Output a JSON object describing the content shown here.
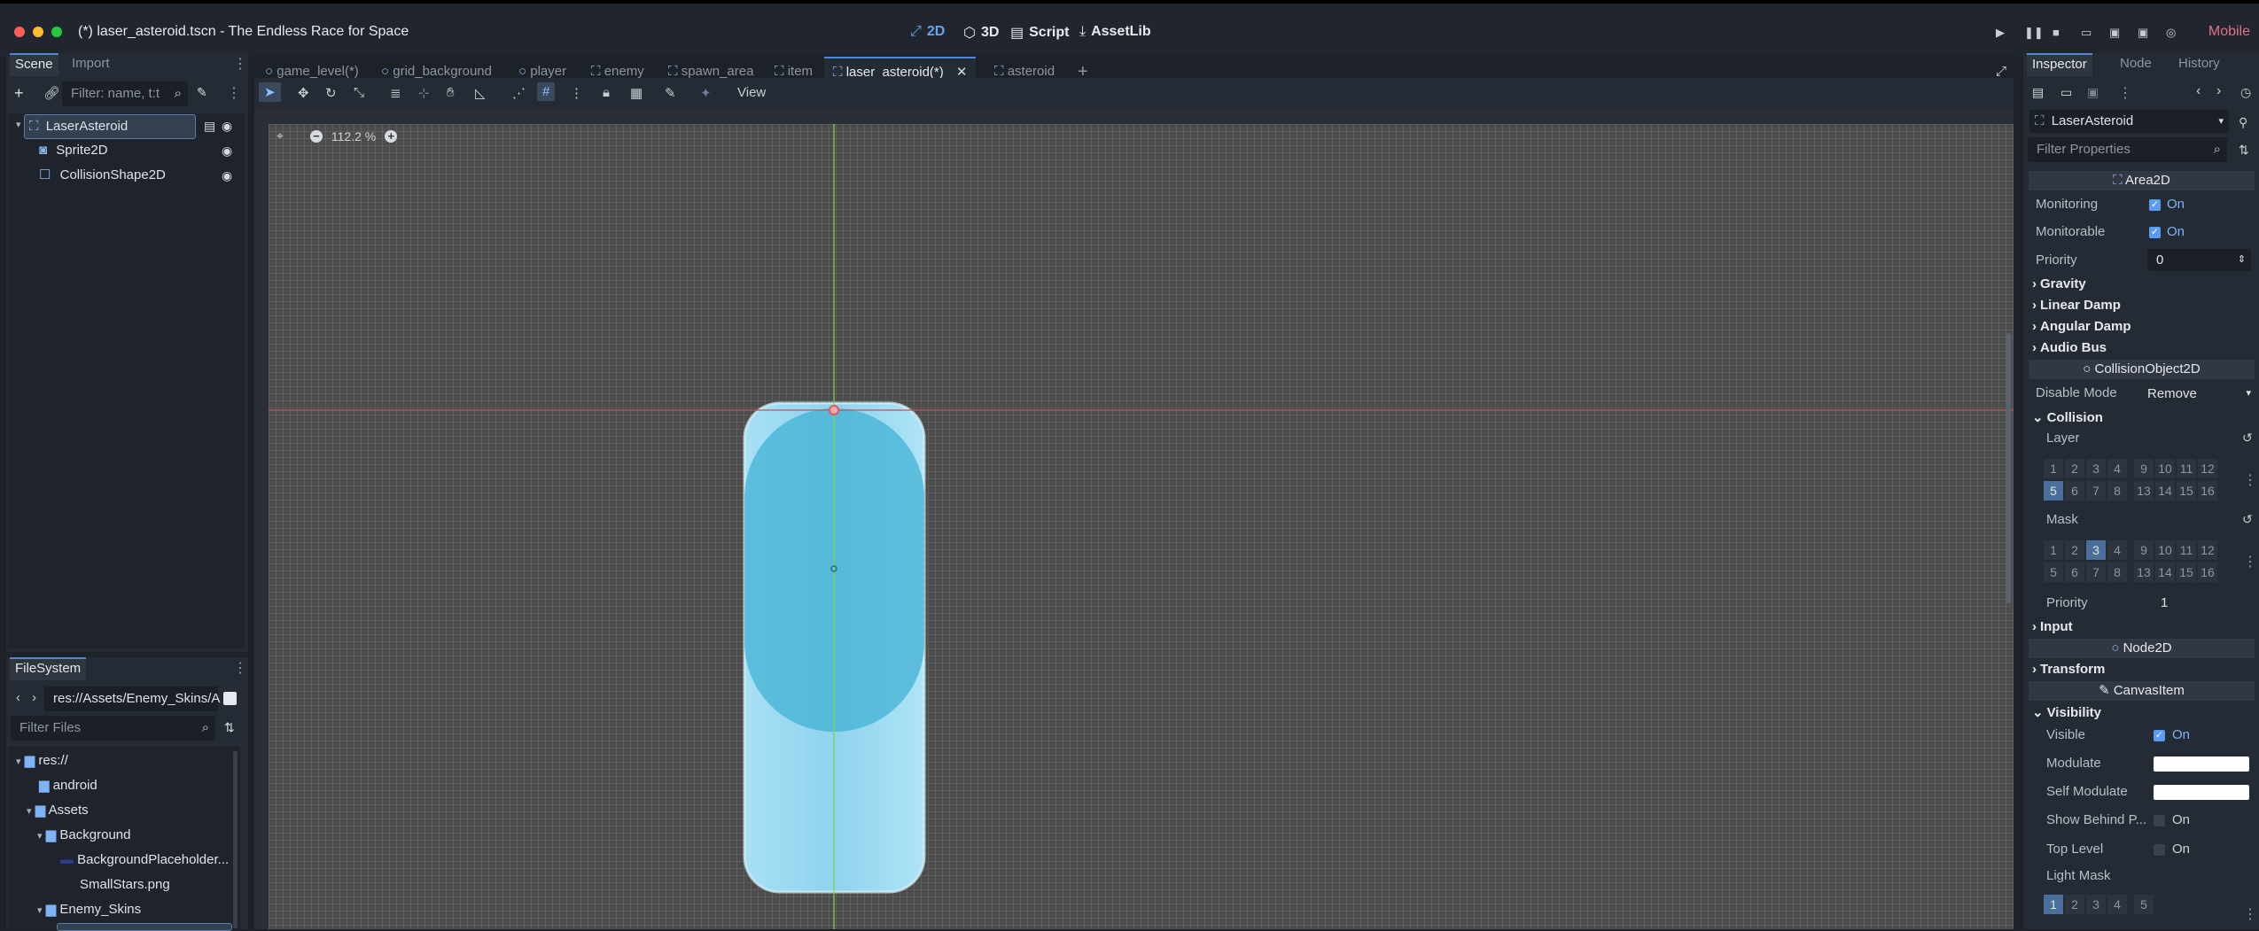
{
  "window": {
    "title": "(*) laser_asteroid.tscn - The Endless Race for Space",
    "modes": [
      "2D",
      "3D",
      "Script",
      "AssetLib"
    ],
    "renderer": "Mobile"
  },
  "scene_dock": {
    "tabs": [
      "Scene",
      "Import"
    ],
    "filter_placeholder": "Filter: name, t:t",
    "nodes": [
      {
        "label": "LaserAsteroid"
      },
      {
        "label": "Sprite2D"
      },
      {
        "label": "CollisionShape2D"
      }
    ]
  },
  "filesystem": {
    "tab": "FileSystem",
    "path": "res://Assets/Enemy_Skins/A",
    "filter_placeholder": "Filter Files",
    "items": [
      {
        "label": "res://"
      },
      {
        "label": "android"
      },
      {
        "label": "Assets"
      },
      {
        "label": "Background"
      },
      {
        "label": "BackgroundPlaceholder..."
      },
      {
        "label": "SmallStars.png"
      },
      {
        "label": "Enemy_Skins"
      }
    ]
  },
  "editor_tabs": [
    "game_level(*)",
    "grid_background",
    "player",
    "enemy",
    "spawn_area",
    "item",
    "laser_asteroid(*)",
    "asteroid"
  ],
  "toolbar": {
    "view_label": "View"
  },
  "viewport": {
    "zoom": "112.2 %"
  },
  "inspector": {
    "tabs": [
      "Inspector",
      "Node",
      "History"
    ],
    "object_name": "LaserAsteroid",
    "filter_placeholder": "Filter Properties",
    "area2d": {
      "header": "Area2D",
      "monitoring_label": "Monitoring",
      "monitoring_value": "On",
      "monitorable_label": "Monitorable",
      "monitorable_value": "On",
      "priority_label": "Priority",
      "priority_value": "0",
      "groups": [
        "Gravity",
        "Linear Damp",
        "Angular Damp",
        "Audio Bus"
      ]
    },
    "collision_object": {
      "header": "CollisionObject2D",
      "disable_mode_label": "Disable Mode",
      "disable_mode_value": "Remove",
      "collision_label": "Collision",
      "layer_label": "Layer",
      "layer_row1": [
        "1",
        "2",
        "3",
        "4",
        "9",
        "10",
        "11",
        "12"
      ],
      "layer_row2": [
        "5",
        "6",
        "7",
        "8",
        "13",
        "14",
        "15",
        "16"
      ],
      "mask_label": "Mask",
      "mask_row1": [
        "1",
        "2",
        "3",
        "4",
        "9",
        "10",
        "11",
        "12"
      ],
      "mask_row2": [
        "5",
        "6",
        "7",
        "8",
        "13",
        "14",
        "15",
        "16"
      ],
      "priority_label": "Priority",
      "priority_value": "1",
      "input_label": "Input"
    },
    "node2d": {
      "header": "Node2D",
      "transform_label": "Transform"
    },
    "canvas_item": {
      "header": "CanvasItem",
      "visibility_label": "Visibility",
      "visible_label": "Visible",
      "visible_value": "On",
      "modulate_label": "Modulate",
      "self_modulate_label": "Self Modulate",
      "show_behind_label": "Show Behind P...",
      "show_behind_value": "On",
      "top_level_label": "Top Level",
      "top_level_value": "On",
      "light_mask_label": "Light Mask",
      "light_mask_row1": [
        "1",
        "2",
        "3",
        "4",
        "5"
      ]
    }
  }
}
